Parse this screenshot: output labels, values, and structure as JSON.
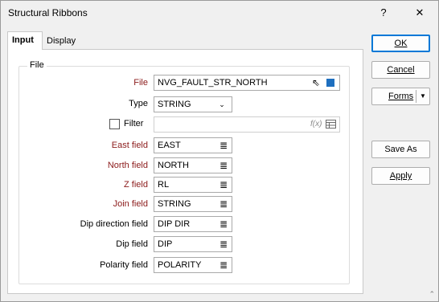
{
  "window": {
    "title": "Structural Ribbons",
    "help_glyph": "?",
    "close_glyph": "✕"
  },
  "tabs": [
    {
      "label": "Input",
      "selected": true
    },
    {
      "label": "Display",
      "selected": false
    }
  ],
  "group": {
    "label": "File"
  },
  "fields": {
    "file": {
      "label": "File",
      "value": "NVG_FAULT_STR_NORTH"
    },
    "type": {
      "label": "Type",
      "value": "STRING"
    },
    "filter": {
      "label": "Filter",
      "value": "",
      "checked": false
    },
    "east": {
      "label": "East field",
      "value": "EAST"
    },
    "north": {
      "label": "North field",
      "value": "NORTH"
    },
    "z": {
      "label": "Z field",
      "value": "RL"
    },
    "join": {
      "label": "Join field",
      "value": "STRING"
    },
    "dipdir": {
      "label": "Dip direction field",
      "value": "DIP DIR"
    },
    "dip": {
      "label": "Dip field",
      "value": "DIP"
    },
    "polarity": {
      "label": "Polarity field",
      "value": "POLARITY"
    }
  },
  "icons": {
    "list": "≣",
    "fx": "f(x)",
    "combo_arrow": "⌄",
    "split_arrow": "▼",
    "pick": "⇖",
    "grip": "⌃"
  },
  "buttons": {
    "ok": "OK",
    "cancel": "Cancel",
    "forms": "Forms",
    "save_as": "Save As",
    "apply": "Apply"
  },
  "colors": {
    "required_label": "#8b1a1a",
    "file_color_swatch": "#1e6fbf",
    "default_button_border": "#0078d7"
  }
}
